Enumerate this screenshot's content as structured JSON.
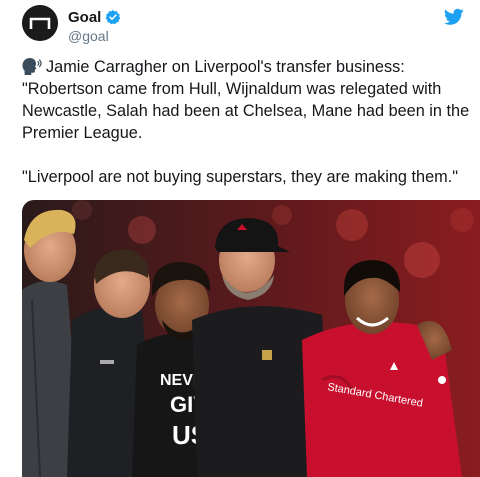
{
  "account": {
    "display_name": "Goal",
    "handle": "@goal",
    "verified": true,
    "avatar_icon": "goal-logo",
    "brand_color": "#1b1b1b"
  },
  "tweet": {
    "text_line1": "Jamie Carragher on Liverpool's transfer business:",
    "text_line2": "\"Robertson came from Hull, Wijnaldum was relegated with",
    "text_line3": "Newcastle, Salah had been at Chelsea, Mane had been in the",
    "text_line4": "Premier League.",
    "quote": "\"Liverpool are not buying superstars, they are making them.\"",
    "leading_icon": "speaking-head-icon"
  },
  "photo": {
    "shirt_sponsor": "Standard Chartered",
    "tshirt_text_line1": "NEVER",
    "tshirt_text_line2": "GIVE",
    "tshirt_text_line3": "US"
  },
  "colors": {
    "twitter_blue": "#1da1f2",
    "liverpool_red": "#c8102e",
    "text_primary": "#14171a",
    "text_secondary": "#657786"
  }
}
